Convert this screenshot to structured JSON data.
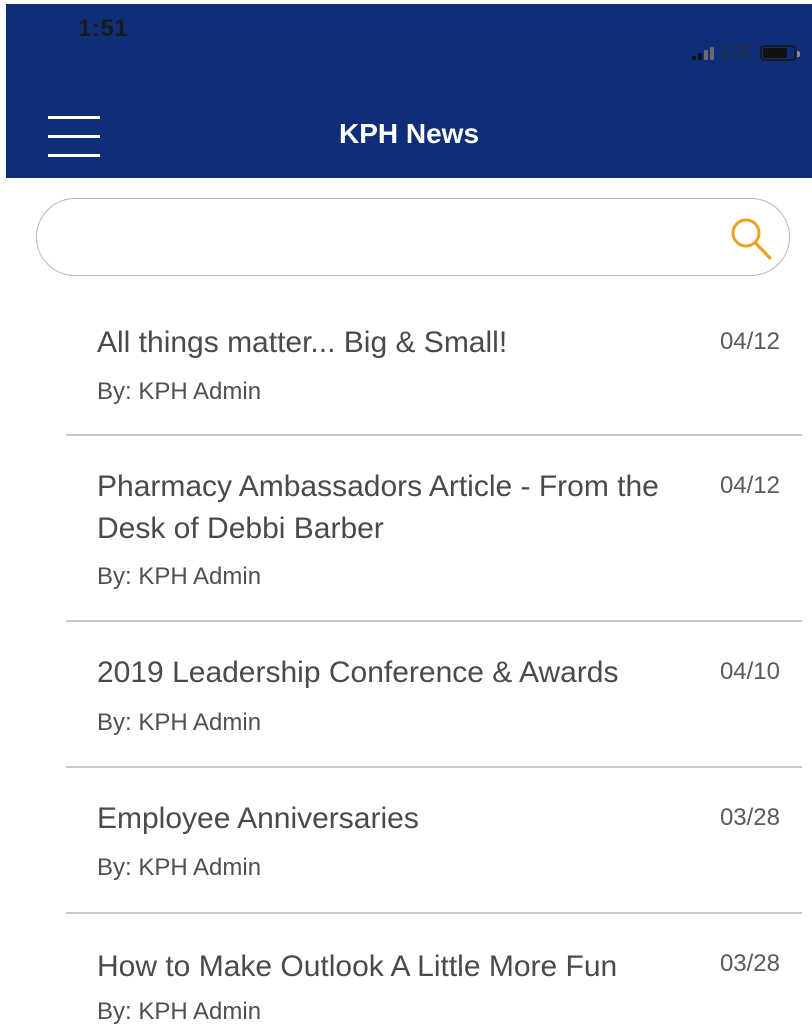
{
  "status_bar": {
    "time": "1:51",
    "network": "LTE"
  },
  "header": {
    "title": "KPH News",
    "background": "#0f2e78"
  },
  "search": {
    "placeholder": "",
    "value": "",
    "icon": "search-icon",
    "icon_color": "#f0a020"
  },
  "news": {
    "items": [
      {
        "title": "All things matter... Big & Small!",
        "author": "By: KPH Admin",
        "date": "04/12"
      },
      {
        "title": "Pharmacy Ambassadors Article - From the Desk of Debbi Barber",
        "author": "By: KPH Admin",
        "date": "04/12"
      },
      {
        "title": "2019 Leadership Conference & Awards",
        "author": "By: KPH Admin",
        "date": "04/10"
      },
      {
        "title": "Employee Anniversaries",
        "author": "By: KPH Admin",
        "date": "03/28"
      },
      {
        "title": "How to Make Outlook A Little More Fun",
        "author": "By: KPH Admin",
        "date": "03/28"
      }
    ]
  }
}
